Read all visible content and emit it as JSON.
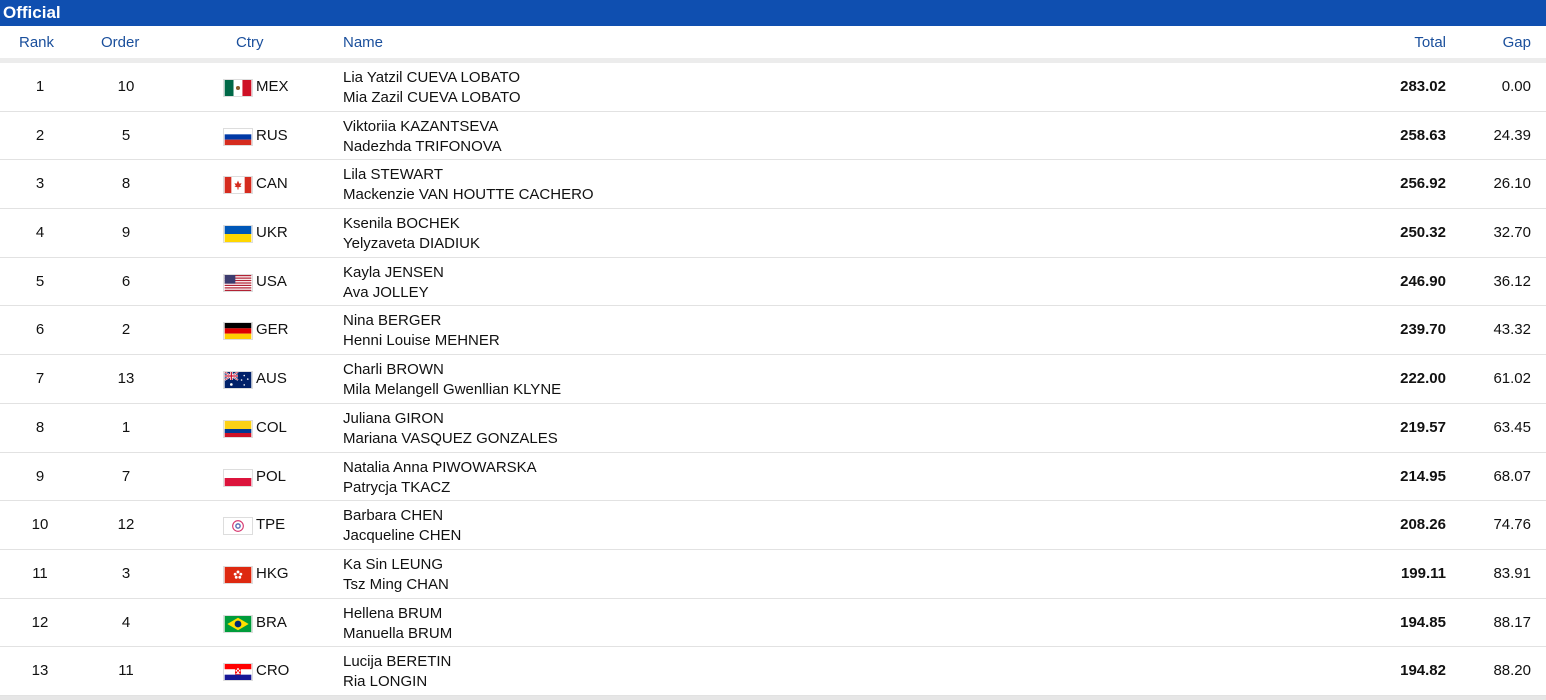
{
  "banner": {
    "title": "Official"
  },
  "headers": {
    "rank": "Rank",
    "order": "Order",
    "ctry": "Ctry",
    "name": "Name",
    "total": "Total",
    "gap": "Gap"
  },
  "rows": [
    {
      "rank": "1",
      "order": "10",
      "ctry": "MEX",
      "flag": "mex-flag-icon",
      "name1": "Lia Yatzil CUEVA LOBATO",
      "name2": "Mia Zazil CUEVA LOBATO",
      "total": "283.02",
      "gap": "0.00"
    },
    {
      "rank": "2",
      "order": "5",
      "ctry": "RUS",
      "flag": "rus-flag-icon",
      "name1": "Viktoriia KAZANTSEVA",
      "name2": "Nadezhda TRIFONOVA",
      "total": "258.63",
      "gap": "24.39"
    },
    {
      "rank": "3",
      "order": "8",
      "ctry": "CAN",
      "flag": "can-flag-icon",
      "name1": "Lila STEWART",
      "name2": "Mackenzie VAN HOUTTE CACHERO",
      "total": "256.92",
      "gap": "26.10"
    },
    {
      "rank": "4",
      "order": "9",
      "ctry": "UKR",
      "flag": "ukr-flag-icon",
      "name1": "Ksenila BOCHEK",
      "name2": "Yelyzaveta DIADIUK",
      "total": "250.32",
      "gap": "32.70"
    },
    {
      "rank": "5",
      "order": "6",
      "ctry": "USA",
      "flag": "usa-flag-icon",
      "name1": "Kayla JENSEN",
      "name2": "Ava JOLLEY",
      "total": "246.90",
      "gap": "36.12"
    },
    {
      "rank": "6",
      "order": "2",
      "ctry": "GER",
      "flag": "ger-flag-icon",
      "name1": "Nina BERGER",
      "name2": "Henni Louise MEHNER",
      "total": "239.70",
      "gap": "43.32"
    },
    {
      "rank": "7",
      "order": "13",
      "ctry": "AUS",
      "flag": "aus-flag-icon",
      "name1": "Charli BROWN",
      "name2": "Mila Melangell Gwenllian KLYNE",
      "total": "222.00",
      "gap": "61.02"
    },
    {
      "rank": "8",
      "order": "1",
      "ctry": "COL",
      "flag": "col-flag-icon",
      "name1": "Juliana GIRON",
      "name2": "Mariana VASQUEZ GONZALES",
      "total": "219.57",
      "gap": "63.45"
    },
    {
      "rank": "9",
      "order": "7",
      "ctry": "POL",
      "flag": "pol-flag-icon",
      "name1": "Natalia Anna PIWOWARSKA",
      "name2": "Patrycja TKACZ",
      "total": "214.95",
      "gap": "68.07"
    },
    {
      "rank": "10",
      "order": "12",
      "ctry": "TPE",
      "flag": "tpe-flag-icon",
      "name1": "Barbara CHEN",
      "name2": "Jacqueline CHEN",
      "total": "208.26",
      "gap": "74.76"
    },
    {
      "rank": "11",
      "order": "3",
      "ctry": "HKG",
      "flag": "hkg-flag-icon",
      "name1": "Ka Sin LEUNG",
      "name2": "Tsz Ming CHAN",
      "total": "199.11",
      "gap": "83.91"
    },
    {
      "rank": "12",
      "order": "4",
      "ctry": "BRA",
      "flag": "bra-flag-icon",
      "name1": "Hellena BRUM",
      "name2": "Manuella BRUM",
      "total": "194.85",
      "gap": "88.17"
    },
    {
      "rank": "13",
      "order": "11",
      "ctry": "CRO",
      "flag": "cro-flag-icon",
      "name1": "Lucija BERETIN",
      "name2": "Ria LONGIN",
      "total": "194.82",
      "gap": "88.20"
    }
  ],
  "colors": {
    "banner": "#0f4fb0",
    "header_text": "#1a4f9c"
  }
}
